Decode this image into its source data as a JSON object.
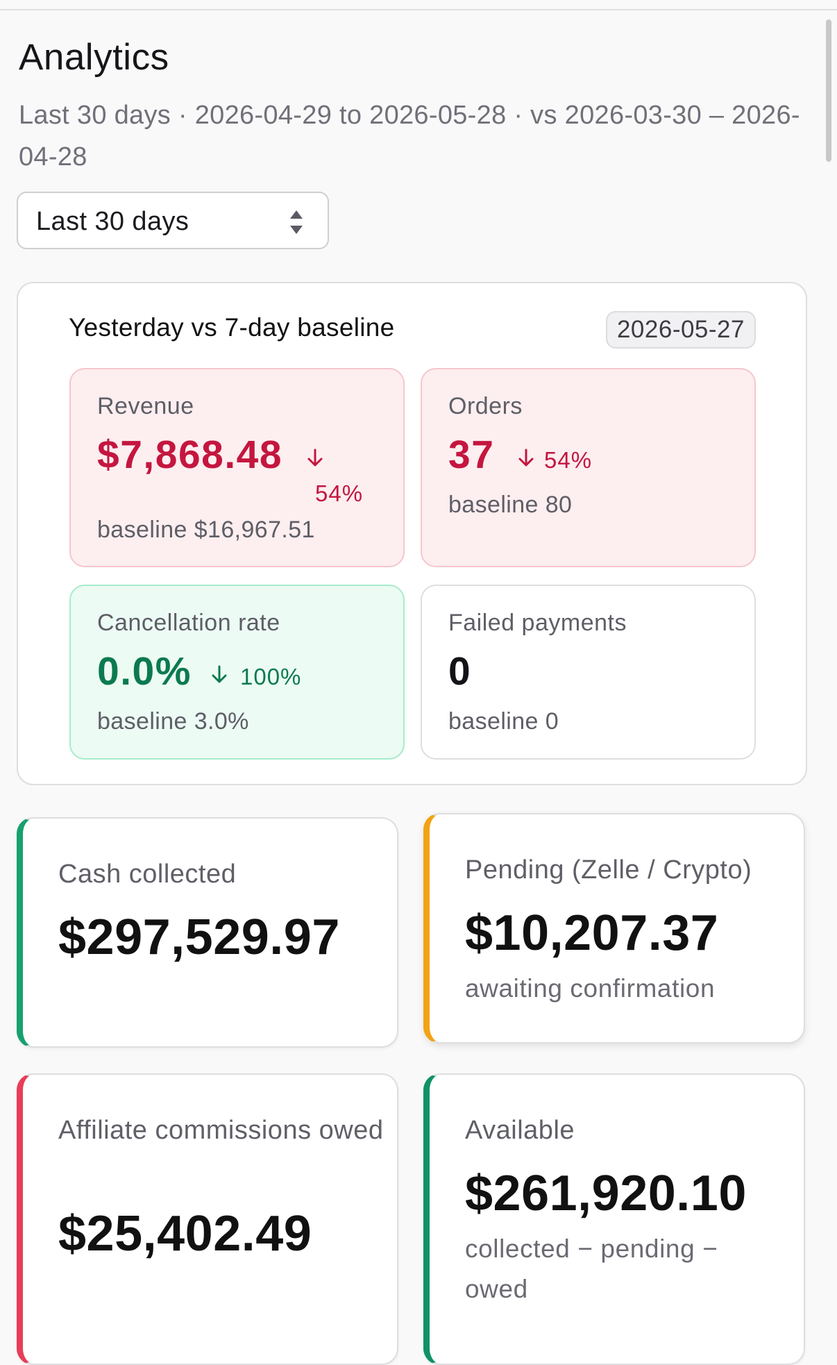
{
  "header": {
    "title": "Analytics",
    "subtitle": "Last 30 days · 2026-04-29 to 2026-05-28 · vs 2026-03-30 – 2026-04-28"
  },
  "range_select": {
    "value": "Last 30 days"
  },
  "baseline": {
    "title": "Yesterday vs 7-day baseline",
    "date": "2026-05-27",
    "metrics": [
      {
        "label": "Revenue",
        "value": "$7,868.48",
        "delta": "54%",
        "baseline": "baseline $16,967.51",
        "status": "bad"
      },
      {
        "label": "Orders",
        "value": "37",
        "delta": "54%",
        "baseline": "baseline 80",
        "status": "bad"
      },
      {
        "label": "Cancellation rate",
        "value": "0.0%",
        "delta": "100%",
        "baseline": "baseline 3.0%",
        "status": "good"
      },
      {
        "label": "Failed payments",
        "value": "0",
        "delta": "",
        "baseline": "baseline 0",
        "status": "neutral"
      }
    ]
  },
  "finance": [
    {
      "label": "Cash collected",
      "value": "$297,529.97",
      "note": "",
      "accent": "#18a06f"
    },
    {
      "label": "Pending (Zelle / Crypto)",
      "value": "$10,207.37",
      "note": "awaiting confirmation",
      "accent": "#f2a314"
    },
    {
      "label": "Affiliate commissions owed",
      "value": "$25,402.49",
      "note": "",
      "accent": "#e83e57"
    },
    {
      "label": "Available",
      "value": "$261,920.10",
      "note": "collected − pending − owed",
      "accent": "#0f9266"
    }
  ],
  "colors": {
    "bad": "#c4163f",
    "good": "#0b7a50"
  },
  "icons": {
    "select": "updown-chevron-icon",
    "delta": "arrow-down-icon"
  }
}
